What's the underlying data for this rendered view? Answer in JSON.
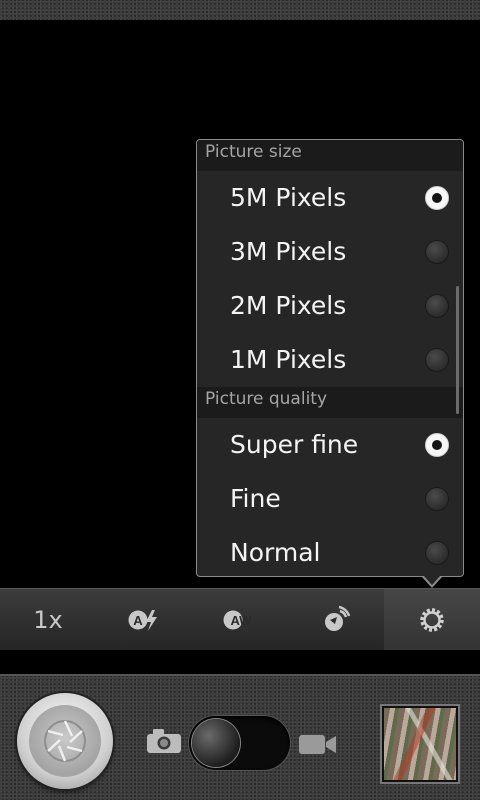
{
  "popup": {
    "sections": [
      {
        "header": "Picture size",
        "options": [
          {
            "label": "5M Pixels",
            "selected": true
          },
          {
            "label": "3M Pixels",
            "selected": false
          },
          {
            "label": "2M Pixels",
            "selected": false
          },
          {
            "label": "1M Pixels",
            "selected": false
          }
        ]
      },
      {
        "header": "Picture quality",
        "options": [
          {
            "label": "Super fine",
            "selected": true
          },
          {
            "label": "Fine",
            "selected": false
          },
          {
            "label": "Normal",
            "selected": false
          }
        ]
      }
    ]
  },
  "toolbar": {
    "zoom_label": "1x",
    "flash_auto_text": "A",
    "white_balance_text": "AW",
    "items": [
      "zoom",
      "flash-auto",
      "white-balance-auto",
      "scene-mode",
      "settings"
    ],
    "active_item": "settings"
  },
  "controls": {
    "mode": "camera",
    "icons": [
      "shutter-icon",
      "camera-icon",
      "video-camera-icon",
      "gallery-thumbnail"
    ]
  },
  "colors": {
    "popup_bg": "#262626",
    "popup_border": "#8a8a8a",
    "text": "#f4f4f4",
    "header_text": "#a5a5a5"
  }
}
